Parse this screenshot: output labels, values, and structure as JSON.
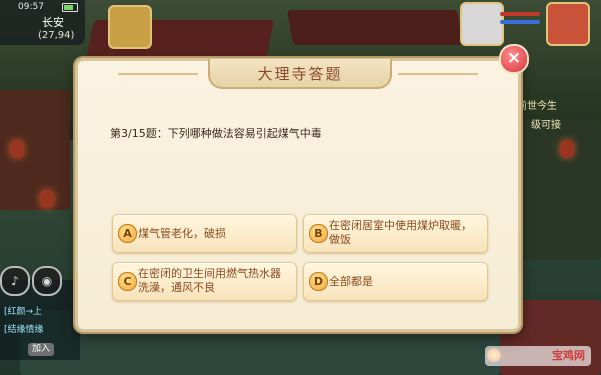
{
  "hud": {
    "time": "09:57",
    "map_name": "长安",
    "coords": "(27,94)"
  },
  "dialog": {
    "title": "大理寺答题",
    "question": "第3/15题：下列哪种做法容易引起煤气中毒",
    "close_label": "×",
    "options": [
      {
        "letter": "A",
        "text": "煤气管老化，破损"
      },
      {
        "letter": "B",
        "text": "在密闭居室中使用煤炉取暖，做饭"
      },
      {
        "letter": "C",
        "text": "在密闭的卫生间用燃气热水器洗澡，通风不良"
      },
      {
        "letter": "D",
        "text": "全部都是"
      }
    ]
  },
  "side_text": {
    "line1": "前世今生",
    "line2": "级可接"
  },
  "chat": {
    "line1": "[红颜→上",
    "line2": "[结缘情缘",
    "join_label": "加入"
  },
  "watermark": "宝鸡网",
  "colors": {
    "title": "#8a4a2c",
    "option_text": "#8a4a1e",
    "close_button": "#d8333d"
  }
}
